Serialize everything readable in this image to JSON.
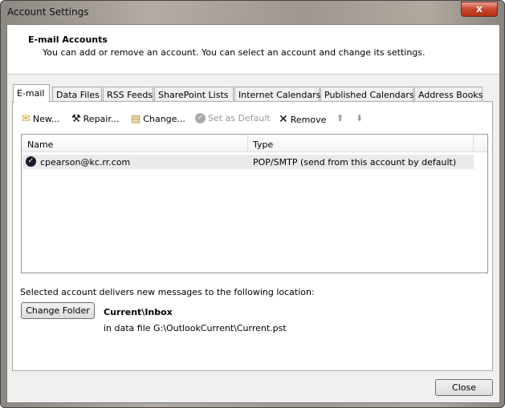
{
  "window": {
    "title": "Account Settings",
    "close_glyph": "x"
  },
  "header": {
    "title": "E-mail Accounts",
    "description": "You can add or remove an account. You can select an account and change its settings."
  },
  "tabs": [
    {
      "label": "E-mail",
      "active": true
    },
    {
      "label": "Data Files"
    },
    {
      "label": "RSS Feeds"
    },
    {
      "label": "SharePoint Lists"
    },
    {
      "label": "Internet Calendars"
    },
    {
      "label": "Published Calendars"
    },
    {
      "label": "Address Books"
    }
  ],
  "toolbar": {
    "new": "New...",
    "repair": "Repair...",
    "change": "Change...",
    "set_default": "Set as Default",
    "remove": "Remove"
  },
  "list": {
    "columns": [
      "Name",
      "Type"
    ],
    "rows": [
      {
        "name": "cpearson@kc.rr.com",
        "type": "POP/SMTP (send from this account by default)"
      }
    ]
  },
  "delivery": {
    "label": "Selected account delivers new messages to the following location:",
    "change_folder": "Change Folder",
    "folder": "Current\\Inbox",
    "data_file": "in data file G:\\OutlookCurrent\\Current.pst"
  },
  "footer": {
    "close": "Close"
  }
}
